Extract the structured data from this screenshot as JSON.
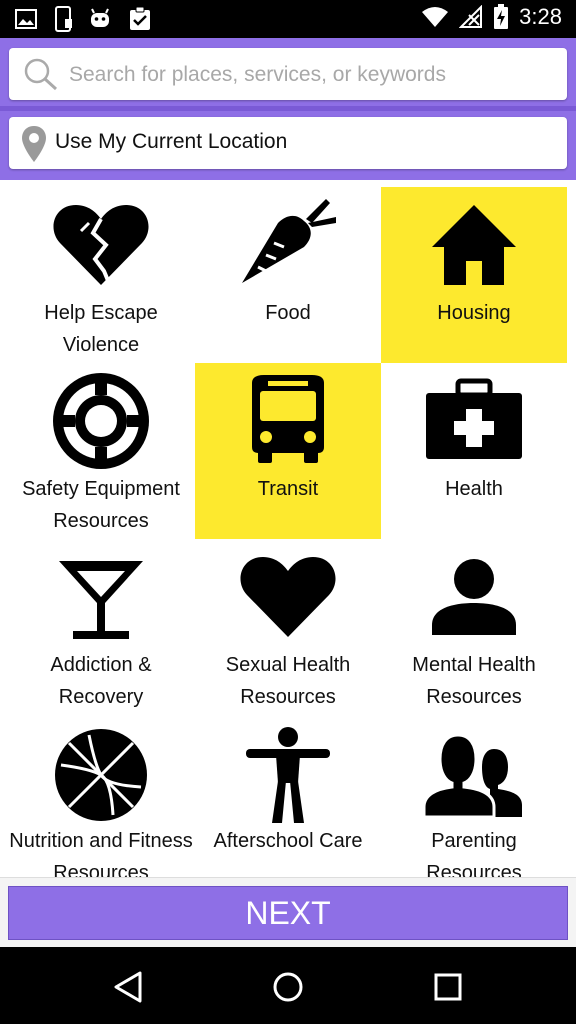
{
  "status_bar": {
    "time": "3:28",
    "left_icons": [
      "image-icon",
      "phone-icon",
      "android-icon",
      "clipboard-check-icon"
    ],
    "right_icons": [
      "wifi-icon",
      "no-signal-icon",
      "battery-charging-icon"
    ]
  },
  "search": {
    "placeholder": "Search for places, services, or keywords",
    "value": ""
  },
  "location": {
    "label": "Use My Current Location"
  },
  "categories": [
    {
      "label": "Help Escape Violence",
      "icon": "broken-heart-icon",
      "selected": false
    },
    {
      "label": "Food",
      "icon": "carrot-icon",
      "selected": false
    },
    {
      "label": "Housing",
      "icon": "house-icon",
      "selected": true
    },
    {
      "label": "Safety Equipment Resources",
      "icon": "life-ring-icon",
      "selected": false
    },
    {
      "label": "Transit",
      "icon": "bus-icon",
      "selected": true
    },
    {
      "label": "Health",
      "icon": "first-aid-kit-icon",
      "selected": false
    },
    {
      "label": "Addiction & Recovery",
      "icon": "cocktail-glass-icon",
      "selected": false
    },
    {
      "label": "Sexual Health Resources",
      "icon": "heart-icon",
      "selected": false
    },
    {
      "label": "Mental Health Resources",
      "icon": "person-icon",
      "selected": false
    },
    {
      "label": "Nutrition and Fitness Resources",
      "icon": "basketball-icon",
      "selected": false
    },
    {
      "label": "Afterschool Care",
      "icon": "child-figure-icon",
      "selected": false
    },
    {
      "label": "Parenting Resources",
      "icon": "two-people-icon",
      "selected": false
    }
  ],
  "next_button": {
    "label": "NEXT"
  },
  "colors": {
    "accent": "#8e6fe6",
    "highlight": "#fde92e"
  },
  "nav_bar": [
    "back-icon",
    "home-icon",
    "recents-icon"
  ]
}
